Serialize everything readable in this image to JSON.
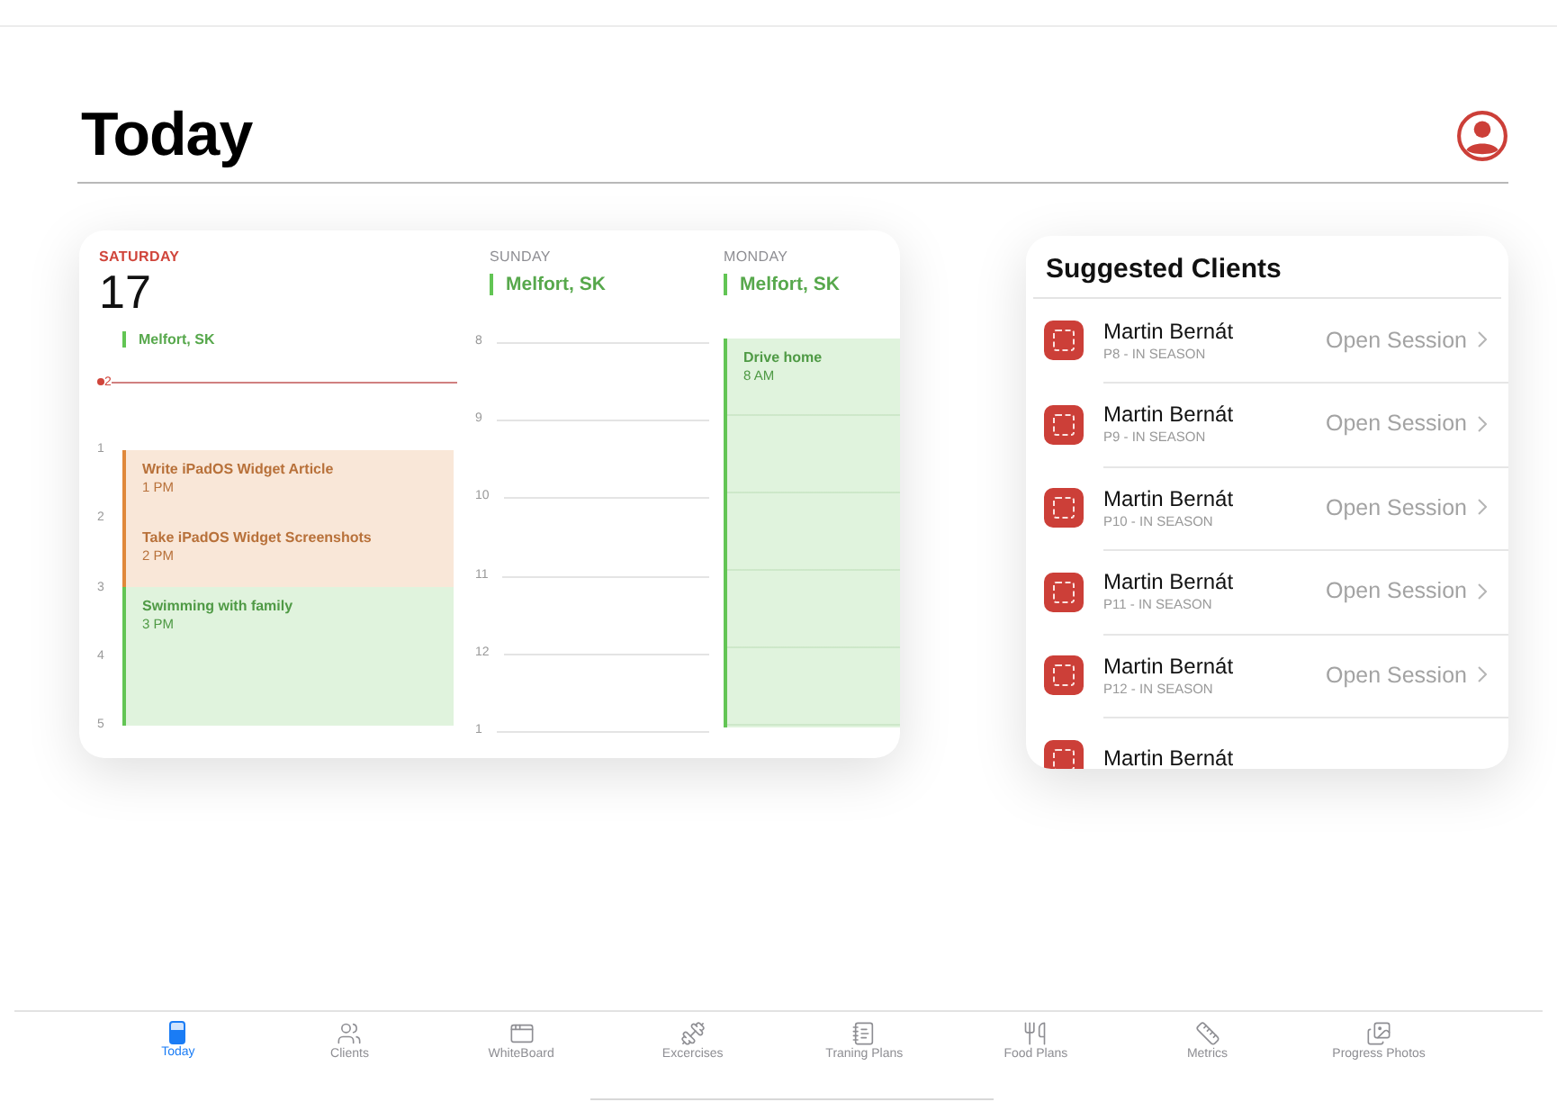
{
  "page": {
    "title": "Today"
  },
  "calendar": {
    "days": [
      {
        "name": "SATURDAY",
        "date": "17",
        "selected": true,
        "location": "Melfort, SK",
        "now_label": "2",
        "hours": [
          "1",
          "2",
          "3",
          "4",
          "5"
        ],
        "events": [
          {
            "title": "Write iPadOS Widget Article",
            "time": "1 PM",
            "kind": "short",
            "color": "#e0883a"
          },
          {
            "title": "Take iPadOS Widget Screenshots",
            "time": "2 PM",
            "kind": "short",
            "color": "#e0883a"
          },
          {
            "title": "Swimming with family",
            "time": "3 PM",
            "kind": "tall",
            "color": "#62c554"
          }
        ]
      },
      {
        "name": "SUNDAY",
        "selected": false,
        "location": "Melfort, SK",
        "hours": [
          "8",
          "9",
          "10",
          "11",
          "12",
          "1"
        ]
      },
      {
        "name": "MONDAY",
        "selected": false,
        "location": "Melfort, SK",
        "events": [
          {
            "title": "Drive home",
            "time": "8 AM",
            "kind": "full",
            "color": "#62c554"
          }
        ]
      }
    ]
  },
  "suggested_clients": {
    "title": "Suggested Clients",
    "rows": [
      {
        "name": "Martin Bernát",
        "detail": "P8 - IN SEASON",
        "action": "Open Session"
      },
      {
        "name": "Martin Bernát",
        "detail": "P9 - IN SEASON",
        "action": "Open Session"
      },
      {
        "name": "Martin Bernát",
        "detail": "P10 - IN SEASON",
        "action": "Open Session"
      },
      {
        "name": "Martin Bernát",
        "detail": "P11 - IN SEASON",
        "action": "Open Session"
      },
      {
        "name": "Martin Bernát",
        "detail": "P12 - IN SEASON",
        "action": "Open Session"
      },
      {
        "name": "Martin Bernát"
      }
    ]
  },
  "tab_bar": [
    {
      "label": "Today",
      "selected": true
    },
    {
      "label": "Clients",
      "selected": false
    },
    {
      "label": "WhiteBoard",
      "selected": false
    },
    {
      "label": "Excercises",
      "selected": false
    },
    {
      "label": "Traning Plans",
      "selected": false
    },
    {
      "label": "Food Plans",
      "selected": false
    },
    {
      "label": "Metrics",
      "selected": false
    },
    {
      "label": "Progress Photos",
      "selected": false
    }
  ]
}
